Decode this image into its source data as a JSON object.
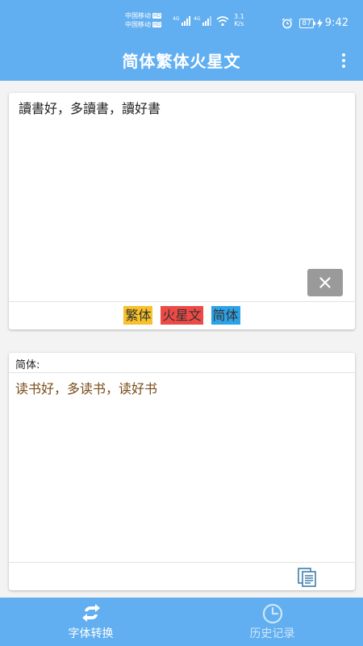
{
  "status_bar": {
    "carrier_1": "中国移动",
    "carrier_2": "中国移动",
    "hd_badge": "HD",
    "net_1": "4G",
    "net_2": "4G",
    "speed_value": "3.1",
    "speed_unit": "K/s",
    "battery": "87",
    "time": "9:42"
  },
  "app_bar": {
    "title": "简体繁体火星文",
    "more_icon": "more-vert-icon"
  },
  "input_card": {
    "text": "讀書好，多讀書，讀好書",
    "clear_icon": "close-icon",
    "modes": [
      {
        "label": "繁体",
        "color": "#f6c12a"
      },
      {
        "label": "火星文",
        "color": "#ee4a45"
      },
      {
        "label": "简体",
        "color": "#2da3e6"
      }
    ]
  },
  "output_card": {
    "label": "简体:",
    "text": "读书好，多读书，读好书",
    "copy_icon": "copy-icon"
  },
  "bottom_nav": {
    "tabs": [
      {
        "label": "字体转换",
        "icon": "swap-arrows-icon",
        "active": true
      },
      {
        "label": "历史记录",
        "icon": "clock-icon",
        "active": false
      }
    ]
  },
  "colors": {
    "primary": "#61aff0",
    "output_text": "#7a4a18",
    "clear_button": "#9a9a9a"
  }
}
